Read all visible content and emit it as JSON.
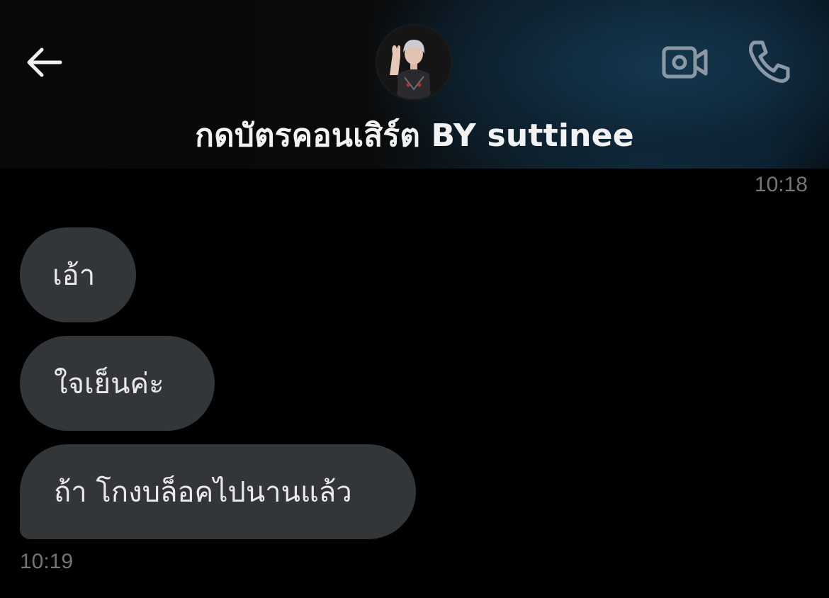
{
  "header": {
    "title": "กดบัตรคอนเสิร์ต BY suttinee",
    "icons": {
      "back": "arrow-left-icon",
      "video": "video-camera-icon",
      "call": "phone-icon"
    }
  },
  "conversation": {
    "timestamp_top": "10:18",
    "messages": [
      {
        "text": "เอ้า"
      },
      {
        "text": "ใจเย็นค่ะ"
      },
      {
        "text": "ถ้า โกงบล็อคไปนานแล้ว"
      }
    ],
    "timestamp_bottom": "10:19"
  },
  "colors": {
    "bubble": "#333639",
    "text": "#e7e9ea",
    "timestamp": "#71767b",
    "background": "#000000"
  }
}
